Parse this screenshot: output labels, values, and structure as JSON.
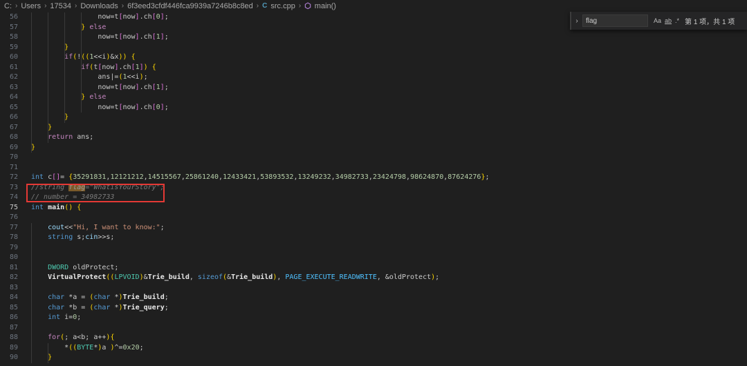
{
  "breadcrumb": {
    "segments": [
      "C:",
      "Users",
      "17534",
      "Downloads",
      "6f3eed3cfdf446fca9939a7246b8c8ed"
    ],
    "file_icon": "C",
    "file": "src.cpp",
    "symbol": "main()"
  },
  "find": {
    "toggle_icon": "chevron-right",
    "query": "flag",
    "opt_case": "Aa",
    "opt_word": "ab",
    "opt_regex": ".*",
    "result_count": "第 1 项，共 1 项"
  },
  "editor": {
    "active_line": "75",
    "lines": [
      {
        "n": "56",
        "t": "                now=t[now].ch[0];"
      },
      {
        "n": "57",
        "t": "            } else"
      },
      {
        "n": "58",
        "t": "                now=t[now].ch[1];"
      },
      {
        "n": "59",
        "t": "        }"
      },
      {
        "n": "60",
        "t": "        if(!((1<<i)&x)) {"
      },
      {
        "n": "61",
        "t": "            if(t[now].ch[1]) {"
      },
      {
        "n": "62",
        "t": "                ans|=(1<<i);"
      },
      {
        "n": "63",
        "t": "                now=t[now].ch[1];"
      },
      {
        "n": "64",
        "t": "            } else"
      },
      {
        "n": "65",
        "t": "                now=t[now].ch[0];"
      },
      {
        "n": "66",
        "t": "        }"
      },
      {
        "n": "67",
        "t": "    }"
      },
      {
        "n": "68",
        "t": "    return ans;"
      },
      {
        "n": "69",
        "t": "}"
      },
      {
        "n": "70",
        "t": ""
      },
      {
        "n": "71",
        "t": ""
      },
      {
        "n": "72",
        "t": "int c[]= {35291831,12121212,14515567,25861240,12433421,53893532,13249232,34982733,23424798,98624870,87624276};"
      },
      {
        "n": "73",
        "t": "//string flag=\"WhatisYourStory\";"
      },
      {
        "n": "74",
        "t": "// number = 34982733"
      },
      {
        "n": "75",
        "t": "int main() {"
      },
      {
        "n": "76",
        "t": ""
      },
      {
        "n": "77",
        "t": "    cout<<\"Hi, I want to know:\";"
      },
      {
        "n": "78",
        "t": "    string s;cin>>s;"
      },
      {
        "n": "79",
        "t": ""
      },
      {
        "n": "80",
        "t": ""
      },
      {
        "n": "81",
        "t": "    DWORD oldProtect;"
      },
      {
        "n": "82",
        "t": "    VirtualProtect((LPVOID)&Trie_build, sizeof(&Trie_build), PAGE_EXECUTE_READWRITE, &oldProtect);"
      },
      {
        "n": "83",
        "t": ""
      },
      {
        "n": "84",
        "t": "    char *a = (char *)Trie_build;"
      },
      {
        "n": "85",
        "t": "    char *b = (char *)Trie_query;"
      },
      {
        "n": "86",
        "t": "    int i=0;"
      },
      {
        "n": "87",
        "t": ""
      },
      {
        "n": "88",
        "t": "    for(; a<b; a++){"
      },
      {
        "n": "89",
        "t": "        *((BYTE*)a )^=0x20;"
      },
      {
        "n": "90",
        "t": "    }"
      }
    ]
  }
}
